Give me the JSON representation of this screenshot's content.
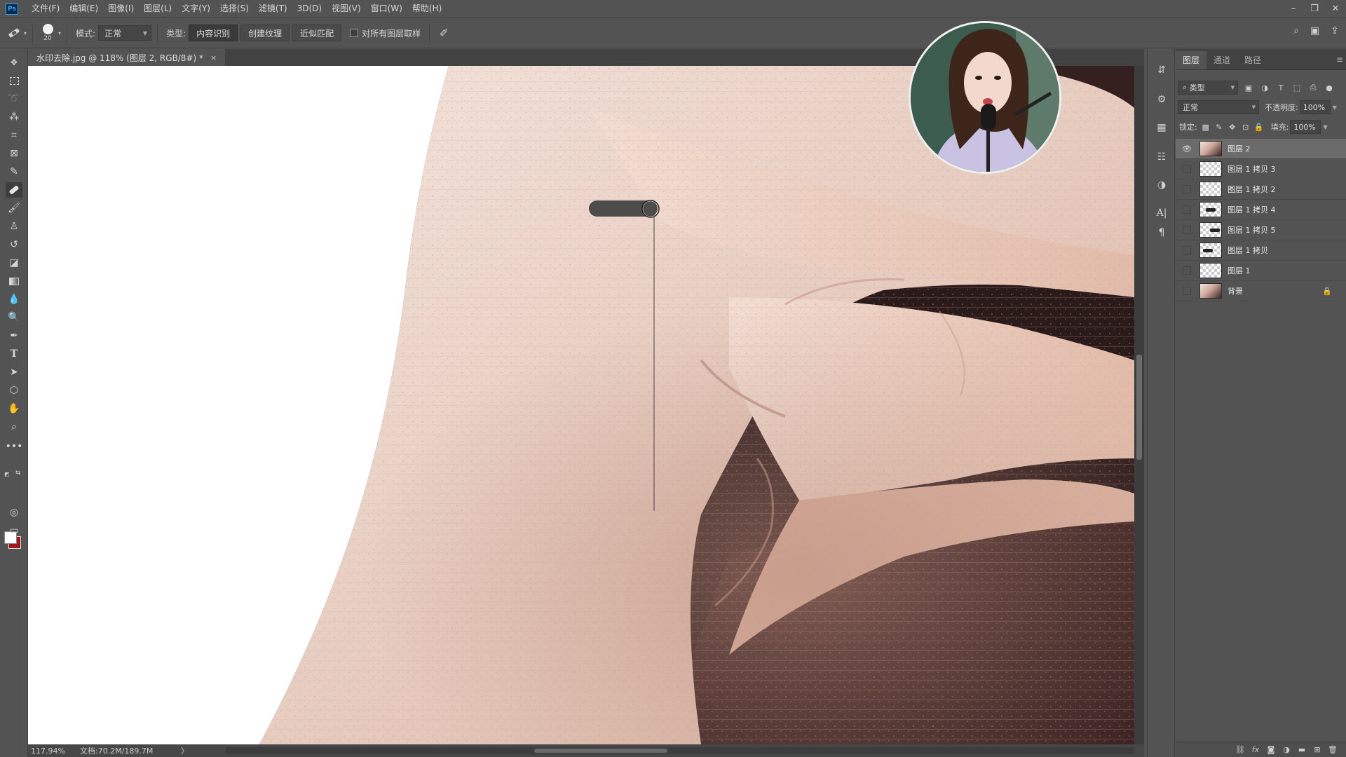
{
  "app": {
    "logo": "Ps"
  },
  "menu": [
    "文件(F)",
    "编辑(E)",
    "图像(I)",
    "图层(L)",
    "文字(Y)",
    "选择(S)",
    "滤镜(T)",
    "3D(D)",
    "视图(V)",
    "窗口(W)",
    "帮助(H)"
  ],
  "options": {
    "brush_size": "20",
    "mode_label": "模式:",
    "mode_value": "正常",
    "type_label": "类型:",
    "type_buttons": [
      "内容识别",
      "创建纹理",
      "近似匹配"
    ],
    "sample_all_label": "对所有图层取样"
  },
  "document": {
    "tab_title": "水印去除.jpg @ 118% (图层 2, RGB/8#) *",
    "close": "×"
  },
  "status": {
    "zoom": "117.94%",
    "doc_info": "文档:70.2M/189.7M",
    "arrow": "〉"
  },
  "layers_panel": {
    "tabs": [
      "图层",
      "通道",
      "路径"
    ],
    "filter_label": "类型",
    "blend_mode": "正常",
    "opacity_label": "不透明度:",
    "opacity_value": "100%",
    "lock_label": "锁定:",
    "fill_label": "填充:",
    "fill_value": "100%",
    "layers": [
      {
        "name": "图层 2",
        "visible": true,
        "selected": true,
        "thumb": "photo"
      },
      {
        "name": "图层 1 拷贝 3",
        "visible": false,
        "selected": false,
        "thumb": "transparent"
      },
      {
        "name": "图层 1 拷贝 2",
        "visible": false,
        "selected": false,
        "thumb": "transparent"
      },
      {
        "name": "图层 1 拷贝 4",
        "visible": false,
        "selected": false,
        "thumb": "mark"
      },
      {
        "name": "图层 1 拷贝 5",
        "visible": false,
        "selected": false,
        "thumb": "mark"
      },
      {
        "name": "图层 1 拷贝",
        "visible": false,
        "selected": false,
        "thumb": "mark"
      },
      {
        "name": "图层 1",
        "visible": false,
        "selected": false,
        "thumb": "transparent"
      },
      {
        "name": "背景",
        "visible": false,
        "selected": false,
        "thumb": "photo",
        "locked": true
      }
    ]
  },
  "colors": {
    "foreground": "#ffffff",
    "background": "#a01818",
    "accent": "#31a8ff"
  }
}
